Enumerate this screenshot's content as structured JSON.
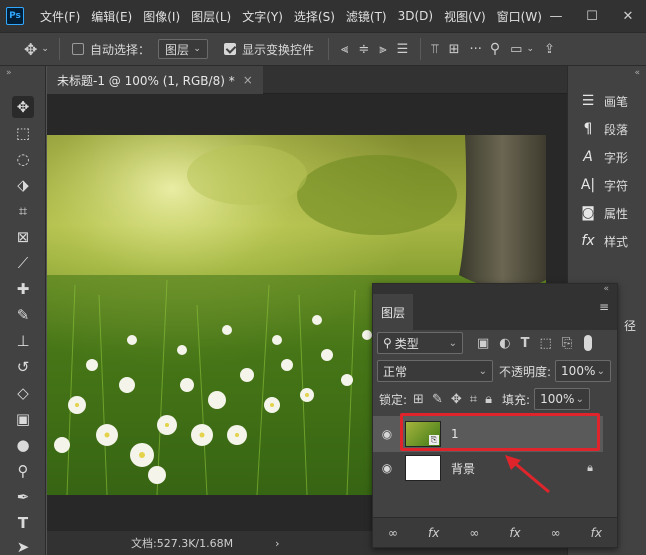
{
  "app": {
    "logo": "Ps"
  },
  "menu": [
    "文件(F)",
    "编辑(E)",
    "图像(I)",
    "图层(L)",
    "文字(Y)",
    "选择(S)",
    "滤镜(T)",
    "3D(D)",
    "视图(V)",
    "窗口(W)"
  ],
  "window_controls": [
    "—",
    "☐",
    "✕"
  ],
  "options": {
    "auto_select_label": "自动选择：",
    "auto_select_target": "图层",
    "show_transform_label": "显示变换控件"
  },
  "document": {
    "tab_title": "未标题-1 @ 100% (1, RGB/8) *",
    "tab_close": "×",
    "status": "文档:527.3K/1.68M",
    "status_arrow": "›"
  },
  "right_panel": {
    "items": [
      {
        "icon": "brush-icon",
        "label": "画笔"
      },
      {
        "icon": "paragraph-icon",
        "label": "段落"
      },
      {
        "icon": "character-icon",
        "label": "字形"
      },
      {
        "icon": "glyph-icon",
        "label": "字符"
      },
      {
        "icon": "properties-icon",
        "label": "属性"
      },
      {
        "icon": "fx-icon",
        "label": "样式"
      }
    ],
    "partial_label": "径"
  },
  "layers_panel": {
    "title": "图层",
    "filter_kind": "类型",
    "blend_mode": "正常",
    "opacity_label": "不透明度:",
    "opacity_value": "100%",
    "lock_label": "锁定:",
    "fill_label": "填充:",
    "fill_value": "100%",
    "layers": [
      {
        "name": "1",
        "selected": true
      },
      {
        "name": "背景",
        "selected": false
      }
    ],
    "footer_icons": [
      "link-icon",
      "fx-icon",
      "link-icon",
      "fx-icon",
      "link-icon",
      "fx-icon"
    ]
  },
  "colors": {
    "accent_highlight": "#e0242b",
    "app_bg": "#535353",
    "panel_bg": "#424242"
  }
}
